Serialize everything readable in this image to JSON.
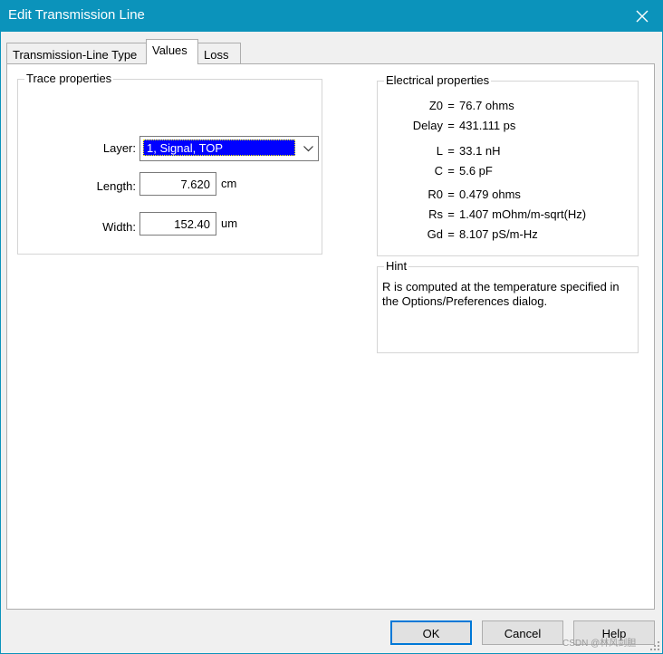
{
  "window": {
    "title": "Edit Transmission Line"
  },
  "tabs": [
    {
      "label": "Transmission-Line Type"
    },
    {
      "label": "Values"
    },
    {
      "label": "Loss"
    }
  ],
  "trace": {
    "legend": "Trace properties",
    "layer_label": "Layer:",
    "layer_value": "1, Signal, TOP",
    "length_label": "Length:",
    "length_value": "7.620",
    "length_unit": "cm",
    "width_label": "Width:",
    "width_value": "152.40",
    "width_unit": "um"
  },
  "electrical": {
    "legend": "Electrical properties",
    "rows": [
      {
        "key": "Z0",
        "value": "76.7 ohms"
      },
      {
        "key": "Delay",
        "value": "431.111 ps"
      },
      {
        "key": "L",
        "value": "33.1 nH"
      },
      {
        "key": "C",
        "value": "5.6 pF"
      },
      {
        "key": "R0",
        "value": "0.479 ohms"
      },
      {
        "key": "Rs",
        "value": "1.407 mOhm/m-sqrt(Hz)"
      },
      {
        "key": "Gd",
        "value": "8.107 pS/m-Hz"
      }
    ]
  },
  "hint": {
    "legend": "Hint",
    "text": "R is computed at the temperature specified in the Options/Preferences dialog."
  },
  "buttons": {
    "ok": "OK",
    "cancel": "Cancel",
    "help": "Help"
  },
  "watermark": "CSDN @林风剑胆",
  "colors": {
    "titlebar": "#0b93bb",
    "selection": "#0000ff",
    "default_button_border": "#0078d7"
  }
}
